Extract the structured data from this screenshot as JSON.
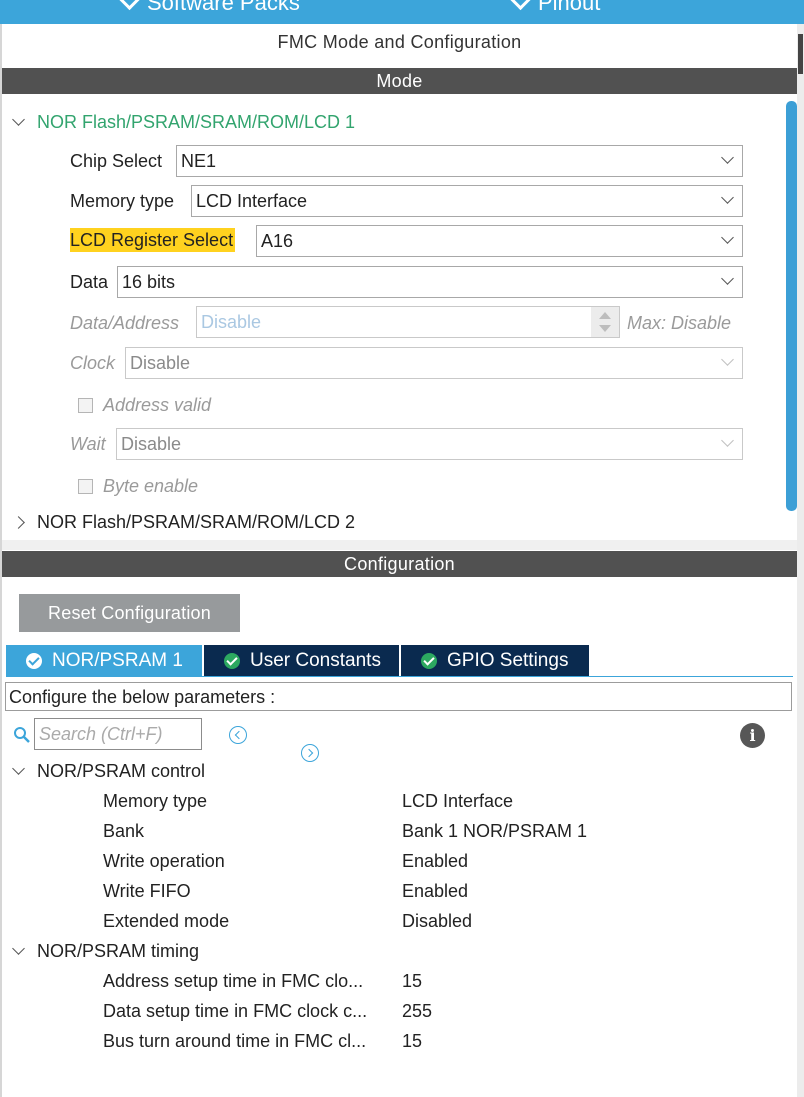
{
  "top_tabs": [
    {
      "label": "Software Packs"
    },
    {
      "label": "Pinout"
    }
  ],
  "panel_title": "FMC Mode and Configuration",
  "mode": {
    "header": "Mode",
    "group1": "NOR Flash/PSRAM/SRAM/ROM/LCD 1",
    "group2": "NOR Flash/PSRAM/SRAM/ROM/LCD 2",
    "chip_select": {
      "label": "Chip Select",
      "value": "NE1"
    },
    "memory_type": {
      "label": "Memory type",
      "value": "LCD Interface"
    },
    "lcd_register_select": {
      "label": "LCD Register Select",
      "value": "A16"
    },
    "data": {
      "label": "Data",
      "value": "16 bits"
    },
    "data_address": {
      "label": "Data/Address",
      "value": "Disable",
      "max": "Max: Disable"
    },
    "clock": {
      "label": "Clock",
      "value": "Disable"
    },
    "address_valid": {
      "label": "Address valid",
      "checked": false
    },
    "wait": {
      "label": "Wait",
      "value": "Disable"
    },
    "byte_enable": {
      "label": "Byte enable",
      "checked": false
    },
    "highlight_color": "#ffd21f",
    "group_color": "#32a46e"
  },
  "configuration": {
    "header": "Configuration",
    "reset_button": "Reset Configuration",
    "tabs": [
      {
        "label": "NOR/PSRAM 1",
        "active": true
      },
      {
        "label": "User Constants",
        "active": false
      },
      {
        "label": "GPIO Settings",
        "active": false
      }
    ],
    "params_hint": "Configure the below parameters :",
    "search_placeholder": "Search (Ctrl+F)",
    "groups": [
      {
        "name": "NOR/PSRAM control",
        "params": [
          {
            "name": "Memory type",
            "value": "LCD Interface"
          },
          {
            "name": "Bank",
            "value": "Bank 1 NOR/PSRAM 1"
          },
          {
            "name": "Write operation",
            "value": "Enabled"
          },
          {
            "name": "Write FIFO",
            "value": "Enabled"
          },
          {
            "name": "Extended mode",
            "value": "Disabled"
          }
        ]
      },
      {
        "name": "NOR/PSRAM timing",
        "params": [
          {
            "name": "Address setup time in FMC clo...",
            "value": "15"
          },
          {
            "name": "Data setup time in FMC clock c...",
            "value": "255"
          },
          {
            "name": "Bus turn around time in FMC cl...",
            "value": "15"
          }
        ]
      }
    ]
  },
  "colors": {
    "accent": "#3ca5da",
    "tab_dark": "#0a2a4f",
    "section_bar": "#515151",
    "button_gray": "#979a9c"
  }
}
